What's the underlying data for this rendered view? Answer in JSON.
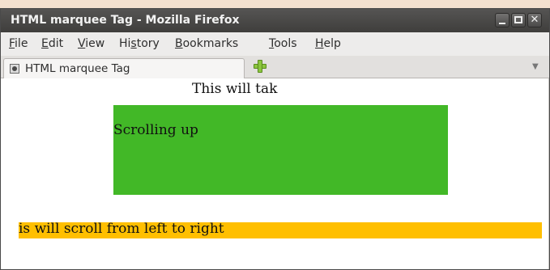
{
  "window": {
    "title": "HTML marquee Tag - Mozilla Firefox",
    "minimize_glyph": "_",
    "close_glyph": "✕"
  },
  "menu": {
    "items": [
      {
        "mnemonic": "F",
        "rest": "ile"
      },
      {
        "mnemonic": "E",
        "rest": "dit"
      },
      {
        "mnemonic": "V",
        "rest": "iew"
      },
      {
        "prefix": "Hi",
        "mnemonic": "s",
        "rest": "tory"
      },
      {
        "mnemonic": "B",
        "rest": "ookmarks"
      },
      {
        "mnemonic": "T",
        "rest": "ools"
      },
      {
        "mnemonic": "H",
        "rest": "elp"
      }
    ]
  },
  "tabs": {
    "active_label": "HTML marquee Tag",
    "list_glyph": "▼"
  },
  "content": {
    "marquee_top_text": "This will tak",
    "marquee_up_text": "Scrolling up",
    "marquee_right_text": "is will scroll from left to right"
  },
  "colors": {
    "green_box": "#42b827",
    "orange_bar": "#ffbf00"
  }
}
